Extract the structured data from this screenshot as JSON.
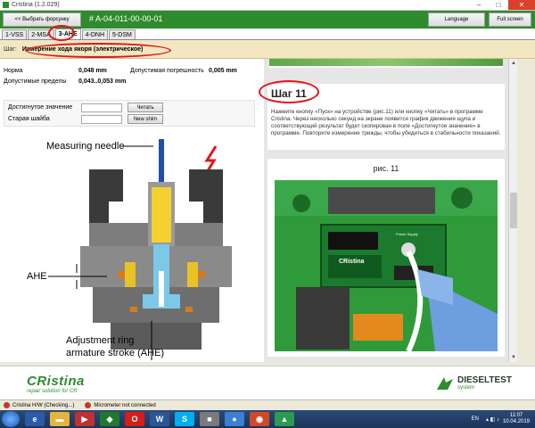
{
  "window": {
    "title": "Cristina (1.2.029)",
    "minimize": "–",
    "maximize": "□",
    "close": "✕"
  },
  "header": {
    "back_button": "<< Выбрать форсунку",
    "injector_code": "# A-04-011-00-00-01",
    "language_button": "Language",
    "fullscreen_button": "Full screen",
    "bg_color": "#2e8b2e"
  },
  "tabs": [
    {
      "label": "1-VSS",
      "active": false
    },
    {
      "label": "2-MSA",
      "active": false
    },
    {
      "label": "3-AHE",
      "active": true
    },
    {
      "label": "4-DNH",
      "active": false
    },
    {
      "label": "5-DSM",
      "active": false
    }
  ],
  "step_bar": {
    "label": "Шаг:",
    "name": "Измерение хода якоря (электрическое)"
  },
  "params": {
    "norm_label": "Норма",
    "norm_value": "0,048 mm",
    "tolerance_label": "Допустимая погрешность",
    "tolerance_value": "0,005 mm",
    "limits_label": "Допустимые пределы",
    "limits_value": "0,043..0,053 mm"
  },
  "inputs": {
    "achieved_label": "Достигнутое значение",
    "achieved_value": "",
    "read_button": "Читать",
    "old_shim_label": "Старая шайба",
    "old_shim_value": "",
    "new_shim_button": "New shim"
  },
  "diagram": {
    "measuring_needle": "Measuring needle",
    "ahe_label": "AHE",
    "adjustment_line1": "Adjustment ring",
    "adjustment_line2": "armature stroke (AHE)"
  },
  "step_card": {
    "title": "Шаг 11",
    "text": "Нажмите кнопку «Пуск» на устройстве (рис.11) или кнопку «Читать» в программе Cristina. Через несколько секунд на экране появится график движения щупа и соответствующий результат будет скопирован в поле «Достигнутое значение» в программе. Повторите измерение трижды, чтобы убедиться в стабильности показаний."
  },
  "photo_card": {
    "caption": "рис. 11",
    "device_brand": "CRistina",
    "device_panel": "Power Supply"
  },
  "footer": {
    "brand": "CRistina",
    "tagline": "repair solution for CR",
    "dt_name": "DIESELTEST",
    "dt_sub": "system"
  },
  "status": {
    "item1": "Cristina H/W (Checking...)",
    "item2": "Micrometer not connected"
  },
  "taskbar": {
    "language": "EN",
    "time": "11:07",
    "date": "10.04.2019"
  },
  "colors": {
    "accent_green": "#2e8b2e",
    "highlight_red": "#e0161b",
    "step_bg": "#f3e7c2"
  }
}
